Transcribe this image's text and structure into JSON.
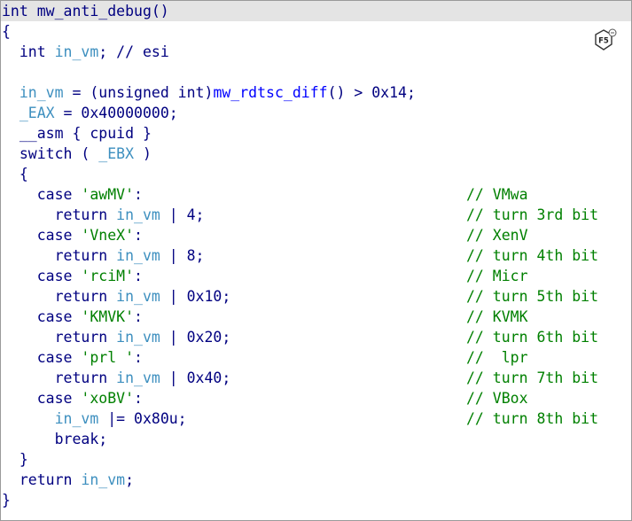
{
  "code": {
    "l0": [
      "int mw_anti_debug()"
    ],
    "l1": [
      "{"
    ],
    "l2": [
      "  int ",
      "in_vm",
      "; // esi"
    ],
    "l3": [
      ""
    ],
    "l4": [
      "  ",
      "in_vm",
      " = (unsigned int)",
      "mw_rdtsc_diff",
      "() > 0x14;"
    ],
    "l5": [
      "  ",
      "_EAX",
      " = 0x40000000;"
    ],
    "l6": [
      "  __asm { cpuid }"
    ],
    "l7": [
      "  switch ( ",
      "_EBX",
      " )"
    ],
    "l8": [
      "  {"
    ],
    "l9": [
      "    case ",
      "'awMV'",
      ":"
    ],
    "l10": [
      "      return ",
      "in_vm",
      " | 4;"
    ],
    "l11": [
      "    case ",
      "'VneX'",
      ":"
    ],
    "l12": [
      "      return ",
      "in_vm",
      " | 8;"
    ],
    "l13": [
      "    case ",
      "'rciM'",
      ":"
    ],
    "l14": [
      "      return ",
      "in_vm",
      " | 0x10;"
    ],
    "l15": [
      "    case ",
      "'KMVK'",
      ":"
    ],
    "l16": [
      "      return ",
      "in_vm",
      " | 0x20;"
    ],
    "l17": [
      "    case ",
      "'prl '",
      ":"
    ],
    "l18": [
      "      return ",
      "in_vm",
      " | 0x40;"
    ],
    "l19": [
      "    case ",
      "'xoBV'",
      ":"
    ],
    "l20": [
      "      ",
      "in_vm",
      " |= 0x80u;"
    ],
    "l21": [
      "      break;"
    ],
    "l22": [
      "  }"
    ],
    "l23": [
      "  return ",
      "in_vm",
      ";"
    ],
    "l24": [
      "}"
    ]
  },
  "comments": {
    "c9": "// VMwa",
    "c10": "// turn 3rd bit",
    "c11": "// XenV",
    "c12": "// turn 4th bit",
    "c13": "// Micr",
    "c14": "// turn 5th bit",
    "c15": "// KVMK",
    "c16": "// turn 6th bit",
    "c17": "//  lpr",
    "c18": "// turn 7th bit",
    "c19": "// VBox",
    "c20": "// turn 8th bit"
  },
  "badge": {
    "label": "F5",
    "icon": "f5-hexagon-icon"
  },
  "colors": {
    "keyword": "#000080",
    "variable": "#3d8fbf",
    "function": "#0000ff",
    "string": "#008000",
    "comment": "#008000",
    "current_line": "#e4e4e4"
  }
}
